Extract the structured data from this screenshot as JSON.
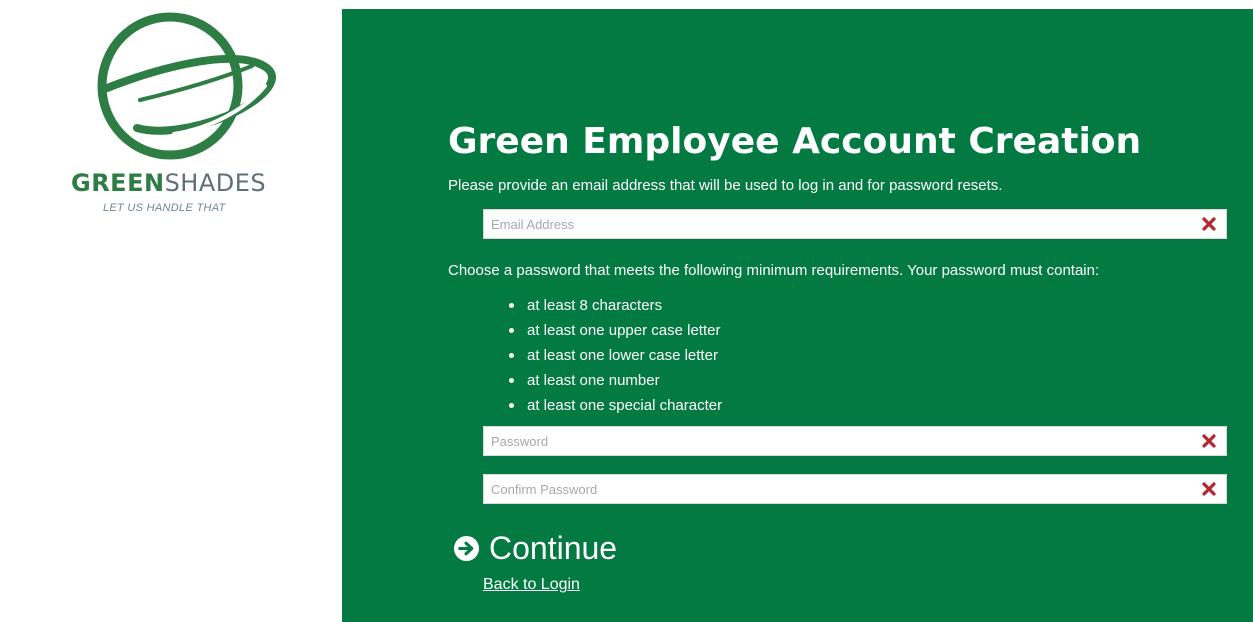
{
  "brand": {
    "name_bold": "GREEN",
    "name_light": "SHADES",
    "tagline": "LET US HANDLE THAT"
  },
  "form": {
    "title": "Green Employee Account Creation",
    "email_instruction": "Please provide an email address that will be used to log in and for password resets.",
    "email": {
      "placeholder": "Email Address",
      "value": ""
    },
    "password_instruction": "Choose a password that meets the following minimum requirements. Your password must contain:",
    "requirements": [
      "at least 8 characters",
      "at least one upper case letter",
      "at least one lower case letter",
      "at least one number",
      "at least one special character"
    ],
    "password": {
      "placeholder": "Password",
      "value": ""
    },
    "confirm_password": {
      "placeholder": "Confirm Password",
      "value": ""
    },
    "continue_label": "Continue",
    "back_link_label": "Back to Login"
  },
  "icons": {
    "logo": "greenshades-logo-e-swoosh",
    "clear": "clear-x-icon",
    "continue": "arrow-circle-right-icon"
  },
  "colors": {
    "panel_green": "#037a42",
    "brand_green": "#2e7d45",
    "clear_icon_red": "#b3272d",
    "text_white": "#ffffff"
  }
}
